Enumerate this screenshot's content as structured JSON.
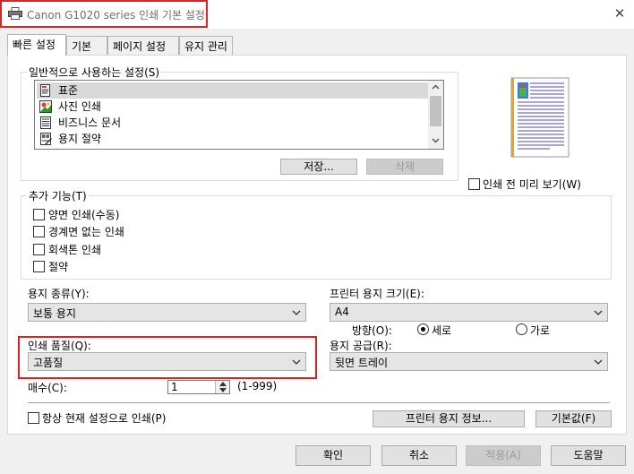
{
  "window": {
    "title": "Canon G1020 series 인쇄 기본 설정",
    "close_glyph": "✕"
  },
  "tabs": [
    {
      "label": "빠른 설정",
      "active": true
    },
    {
      "label": "기본"
    },
    {
      "label": "페이지 설정"
    },
    {
      "label": "유지 관리"
    }
  ],
  "common_settings": {
    "label": "일반적으로 사용하는 설정(S)",
    "items": [
      {
        "label": "표준",
        "icon": "standard-doc-icon",
        "selected": true
      },
      {
        "label": "사진 인쇄",
        "icon": "photo-print-icon"
      },
      {
        "label": "비즈니스 문서",
        "icon": "business-doc-icon"
      },
      {
        "label": "용지 절약",
        "icon": "paper-saving-icon"
      }
    ],
    "save_label": "저장...",
    "delete_label": "삭제"
  },
  "preview": {
    "checkbox_label": "인쇄 전 미리 보기(W)",
    "checked": false
  },
  "additional_features": {
    "label": "추가 기능(T)",
    "items": [
      {
        "label": "양면 인쇄(수동)",
        "checked": false
      },
      {
        "label": "경계면 없는 인쇄",
        "checked": false
      },
      {
        "label": "회색톤 인쇄",
        "checked": false
      },
      {
        "label": "절약",
        "checked": false
      }
    ]
  },
  "media_type": {
    "label": "용지 종류(Y):",
    "value": "보통 용지"
  },
  "printer_paper_size": {
    "label": "프린터 용지 크기(E):",
    "value": "A4"
  },
  "orientation": {
    "label": "방향(O):",
    "portrait": "세로",
    "landscape": "가로",
    "selected": "portrait"
  },
  "print_quality": {
    "label": "인쇄 품질(Q):",
    "value": "고품질"
  },
  "paper_source": {
    "label": "용지 공급(R):",
    "value": "뒷면 트레이"
  },
  "copies": {
    "label": "매수(C):",
    "value": "1",
    "range": "(1-999)"
  },
  "always_print": {
    "label": "항상 현재 설정으로 인쇄(P)",
    "checked": false
  },
  "printer_paper_info_label": "프린터 용지 정보...",
  "defaults_label": "기본값(F)",
  "footer": {
    "ok": "확인",
    "cancel": "취소",
    "apply": "적용(A)",
    "help": "도움말"
  }
}
